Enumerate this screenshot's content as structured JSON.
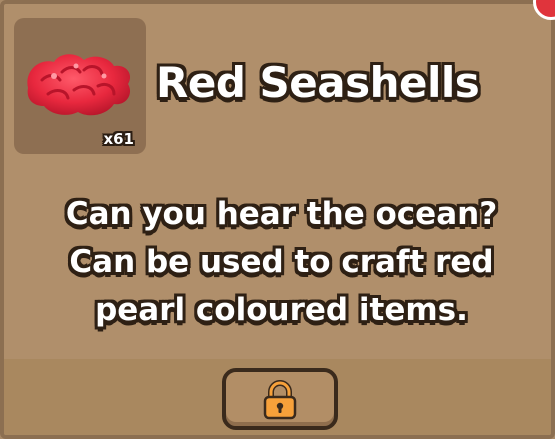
{
  "item": {
    "name": "Red Seashells",
    "count_label": "x61",
    "icon": "red-seashell-icon",
    "icon_color": "#e8283e"
  },
  "description": {
    "lines": [
      "Can you hear the ocean?",
      "Can be used to craft red",
      "pearl coloured items."
    ]
  },
  "actions": {
    "lock_icon": "padlock-icon",
    "lock_color": "#f7a13a"
  },
  "colors": {
    "panel": "#b08f6b",
    "slot": "#8e6f52",
    "text": "#ffffff",
    "outline": "#2e2014",
    "close_corner": "#e0343c"
  }
}
